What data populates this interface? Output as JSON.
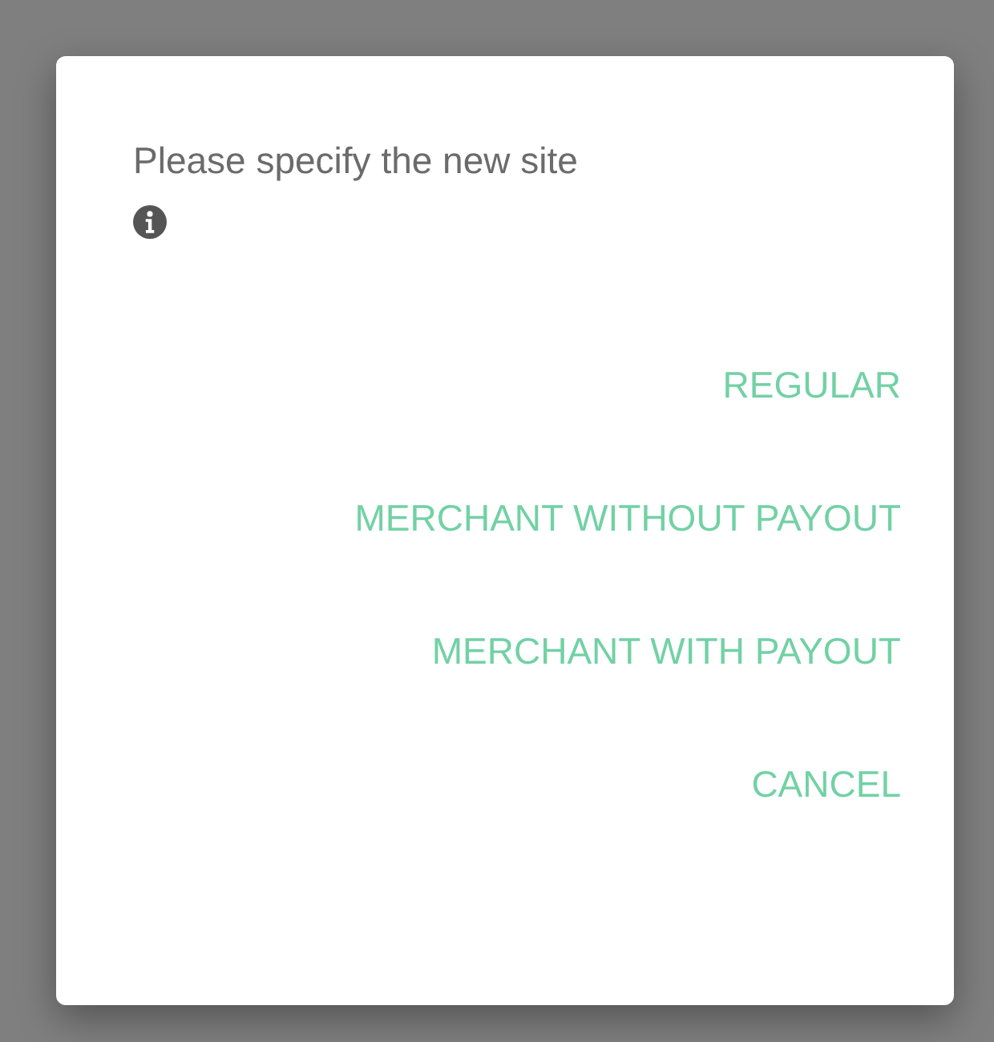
{
  "dialog": {
    "message": "Please specify the new site",
    "buttons": [
      {
        "label": "REGULAR"
      },
      {
        "label": "MERCHANT WITHOUT PAYOUT"
      },
      {
        "label": "MERCHANT WITH PAYOUT"
      },
      {
        "label": "CANCEL"
      }
    ]
  }
}
